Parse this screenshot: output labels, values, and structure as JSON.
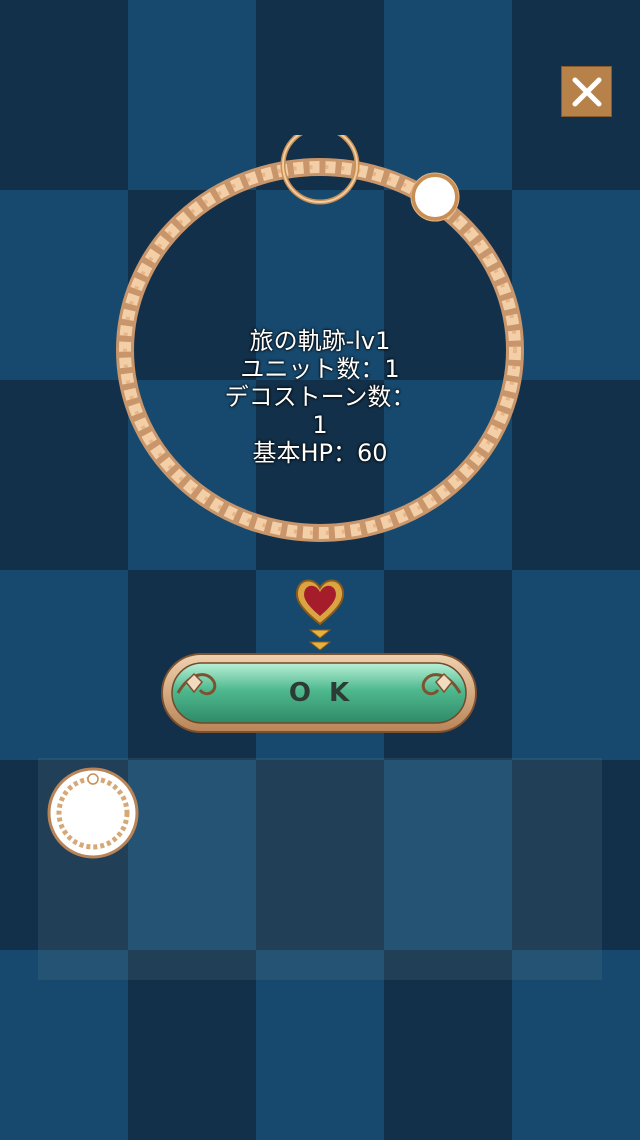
{
  "dialog": {
    "close_icon": "close-x-icon",
    "bracelet_name": "旅の軌跡-lv1",
    "units_line": "ユニット数：1",
    "decostone_line1": "デコストーン数：",
    "decostone_line2": "1",
    "hp_line": "基本HP：60",
    "ok_label": "OK"
  },
  "inventory": {
    "slot_icon": "bracelet-icon"
  },
  "colors": {
    "close_button": "#b7824a",
    "ok_button": "#3f9a78",
    "rope": "#f0c49a"
  }
}
